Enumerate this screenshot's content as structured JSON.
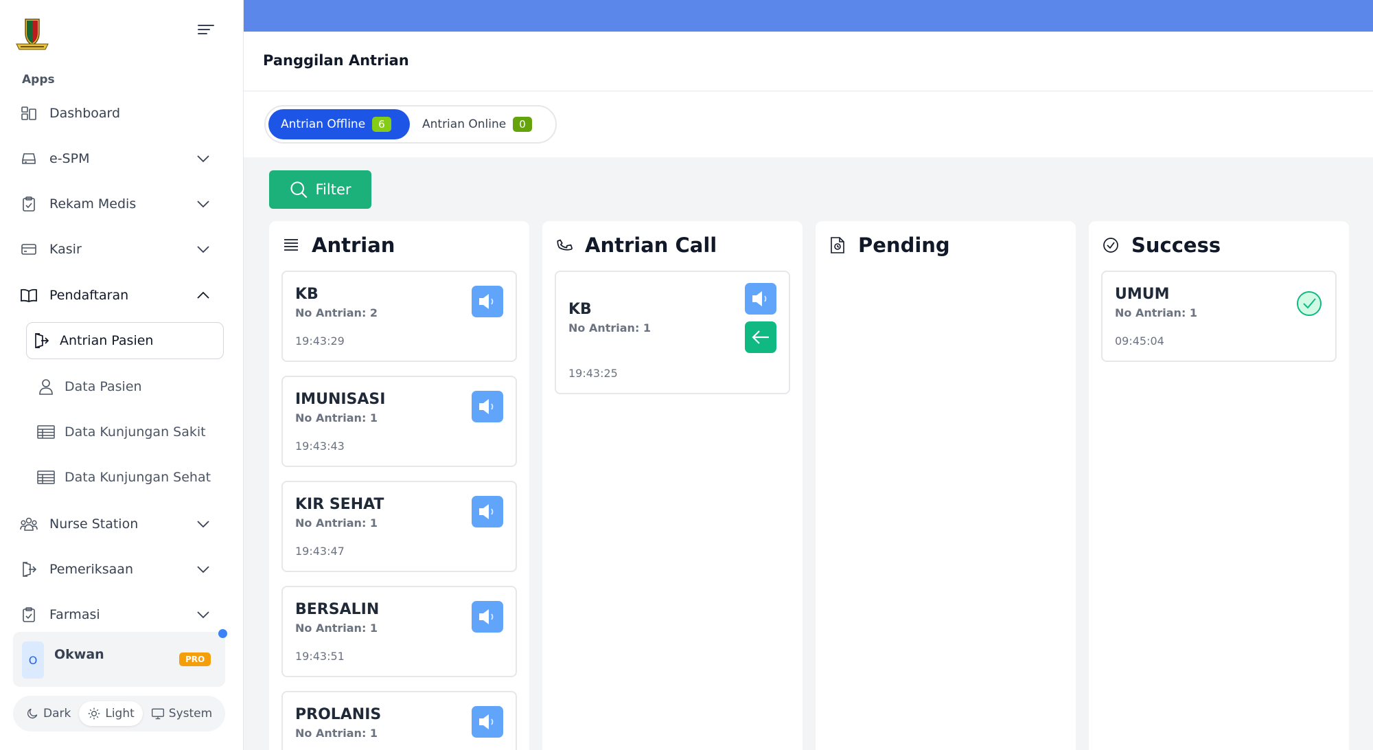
{
  "sidebar": {
    "section_label": "Apps",
    "items": [
      {
        "label": "Dashboard",
        "icon": "dashboard-icon"
      },
      {
        "label": "e-SPM",
        "icon": "drive-icon"
      },
      {
        "label": "Rekam Medis",
        "icon": "clipboard-icon"
      },
      {
        "label": "Kasir",
        "icon": "card-icon"
      },
      {
        "label": "Pendaftaran",
        "icon": "book-icon"
      },
      {
        "label": "Nurse Station",
        "icon": "users-icon"
      },
      {
        "label": "Pemeriksaan",
        "icon": "exit-icon"
      },
      {
        "label": "Farmasi",
        "icon": "clipboard-icon"
      }
    ],
    "sub_items": [
      {
        "label": "Antrian Pasien",
        "icon": "login-icon"
      },
      {
        "label": "Data Pasien",
        "icon": "user-icon"
      },
      {
        "label": "Data Kunjungan Sakit",
        "icon": "table-icon"
      },
      {
        "label": "Data Kunjungan Sehat",
        "icon": "table-icon"
      }
    ],
    "user": {
      "avatar": "O",
      "name": "Okwan",
      "badge": "PRO"
    },
    "theme": {
      "dark": "Dark",
      "light": "Light",
      "system": "System",
      "selected": "Light"
    }
  },
  "header": {
    "title": "Panggilan Antrian",
    "topbar_color": "#5b86ea"
  },
  "tabs": [
    {
      "label": "Antrian Offline",
      "count": "6"
    },
    {
      "label": "Antrian Online",
      "count": "0"
    }
  ],
  "filter_label": "Filter",
  "columns": {
    "antrian": {
      "title": "Antrian",
      "cards": [
        {
          "name": "KB",
          "no": "No Antrian: 2",
          "time": "19:43:29"
        },
        {
          "name": "IMUNISASI",
          "no": "No Antrian: 1",
          "time": "19:43:43"
        },
        {
          "name": "KIR SEHAT",
          "no": "No Antrian: 1",
          "time": "19:43:47"
        },
        {
          "name": "BERSALIN",
          "no": "No Antrian: 1",
          "time": "19:43:51"
        },
        {
          "name": "PROLANIS",
          "no": "No Antrian: 1",
          "time": ""
        }
      ]
    },
    "call": {
      "title": "Antrian Call",
      "cards": [
        {
          "name": "KB",
          "no": "No Antrian: 1",
          "time": "19:43:25"
        }
      ]
    },
    "pending": {
      "title": "Pending"
    },
    "success": {
      "title": "Success",
      "cards": [
        {
          "name": "UMUM",
          "no": "No Antrian: 1",
          "time": "09:45:04"
        }
      ]
    }
  },
  "colors": {
    "primary": "#1d55e6",
    "green": "#1cb07a",
    "speaker": "#60a5fa",
    "badge": "#84cc16",
    "pro": "#f59e0b"
  }
}
